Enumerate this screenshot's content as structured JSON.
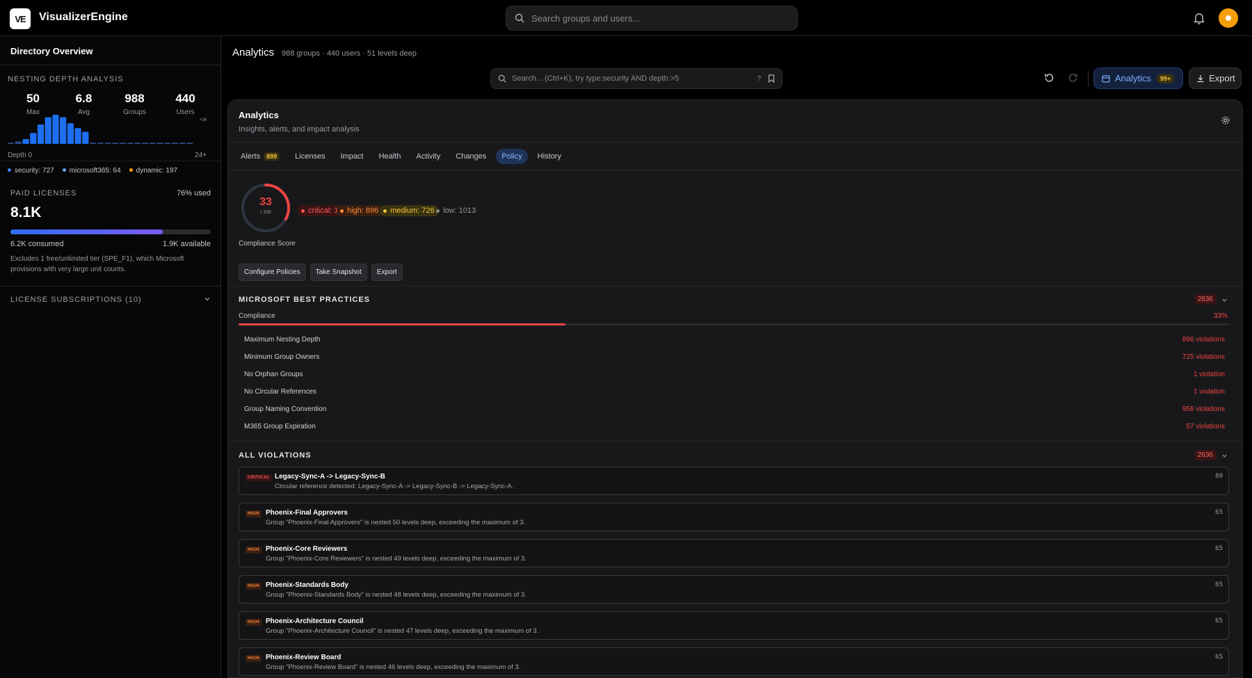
{
  "app": {
    "name": "VisualizerEngine",
    "logo_text": "VE"
  },
  "top_search": {
    "placeholder": "Search groups and users..."
  },
  "sidebar": {
    "title": "Directory Overview",
    "nesting": {
      "label": "NESTING DEPTH ANALYSIS",
      "stats": [
        {
          "value": "50",
          "label": "Max"
        },
        {
          "value": "6.8",
          "label": "Avg"
        },
        {
          "value": "988",
          "label": "Groups"
        },
        {
          "value": "440",
          "label": "Users"
        }
      ],
      "axis_start": "Depth 0",
      "axis_end": "24+",
      "overflow_label": "+26",
      "histogram": [
        1,
        2,
        4,
        9,
        16,
        22,
        24,
        22,
        17,
        13,
        10,
        1,
        1,
        1,
        1,
        1,
        1,
        1,
        1,
        1,
        1,
        1,
        1,
        1,
        1
      ],
      "legend": [
        {
          "label": "security: 727",
          "color": "#3b82f6"
        },
        {
          "label": "microsoft365: 64",
          "color": "#60a5fa"
        },
        {
          "label": "dynamic: 197",
          "color": "#f59e0b"
        }
      ]
    },
    "licenses": {
      "label": "PAID LICENSES",
      "used_pct_text": "76% used",
      "used_fraction": 0.76,
      "total": "8.1K",
      "consumed": "6.2K consumed",
      "available": "1.9K available",
      "note": "Excludes 1 free/unlimited tier (SPE_F1), which Microsoft provisions with very large unit counts."
    },
    "subscriptions_label": "LICENSE SUBSCRIPTIONS (10)"
  },
  "header": {
    "title": "Analytics",
    "subtitle": "988 groups · 440 users · 51 levels deep",
    "search_placeholder": "Search... (Ctrl+K), try type:security AND depth:>5",
    "search_help": "?",
    "analytics_button": "Analytics",
    "analytics_badge": "99+",
    "export_button": "Export"
  },
  "panel": {
    "title": "Analytics",
    "subtitle": "Insights, alerts, and impact analysis",
    "tabs": [
      {
        "label": "Alerts",
        "count": "899"
      },
      {
        "label": "Licenses"
      },
      {
        "label": "Impact"
      },
      {
        "label": "Health"
      },
      {
        "label": "Activity"
      },
      {
        "label": "Changes"
      },
      {
        "label": "Policy",
        "active": true
      },
      {
        "label": "History"
      }
    ],
    "score": {
      "value": "33",
      "denominator": "/ 100",
      "fraction": 0.33,
      "label": "Compliance Score"
    },
    "severities": {
      "critical": "critical: 1",
      "high": "high: 896",
      "medium": "medium: 726",
      "low": "low: 1013"
    },
    "actions": [
      "Configure Policies",
      "Take Snapshot",
      "Export"
    ],
    "best_practices": {
      "title": "MICROSOFT BEST PRACTICES",
      "count": "2636",
      "compliance_label": "Compliance",
      "compliance_pct": "33%",
      "compliance_fraction": 0.33,
      "rules": [
        {
          "name": "Maximum Nesting Depth",
          "violations": "896 violations"
        },
        {
          "name": "Minimum Group Owners",
          "violations": "725 violations"
        },
        {
          "name": "No Orphan Groups",
          "violations": "1 violation"
        },
        {
          "name": "No Circular References",
          "violations": "1 violation"
        },
        {
          "name": "Group Naming Convention",
          "violations": "956 violations"
        },
        {
          "name": "M365 Group Expiration",
          "violations": "57 violations"
        }
      ]
    },
    "all_violations": {
      "title": "ALL VIOLATIONS",
      "count": "2636",
      "items": [
        {
          "severity": "CRITICAL",
          "sev_class": "critical",
          "title": "Legacy-Sync-A -> Legacy-Sync-B",
          "desc": "Circular reference detected: Legacy-Sync-A -> Legacy-Sync-B -> Legacy-Sync-A.",
          "score": "80"
        },
        {
          "severity": "HIGH",
          "sev_class": "high",
          "title": "Phoenix-Final Approvers",
          "desc": "Group \"Phoenix-Final Approvers\" is nested 50 levels deep, exceeding the maximum of 3.",
          "score": "65"
        },
        {
          "severity": "HIGH",
          "sev_class": "high",
          "title": "Phoenix-Core Reviewers",
          "desc": "Group \"Phoenix-Core Reviewers\" is nested 49 levels deep, exceeding the maximum of 3.",
          "score": "65"
        },
        {
          "severity": "HIGH",
          "sev_class": "high",
          "title": "Phoenix-Standards Body",
          "desc": "Group \"Phoenix-Standards Body\" is nested 48 levels deep, exceeding the maximum of 3.",
          "score": "65"
        },
        {
          "severity": "HIGH",
          "sev_class": "high",
          "title": "Phoenix-Architecture Council",
          "desc": "Group \"Phoenix-Architecture Council\" is nested 47 levels deep, exceeding the maximum of 3.",
          "score": "65"
        },
        {
          "severity": "HIGH",
          "sev_class": "high",
          "title": "Phoenix-Review Board",
          "desc": "Group \"Phoenix-Review Board\" is nested 46 levels deep, exceeding the maximum of 3.",
          "score": "65"
        }
      ]
    }
  }
}
